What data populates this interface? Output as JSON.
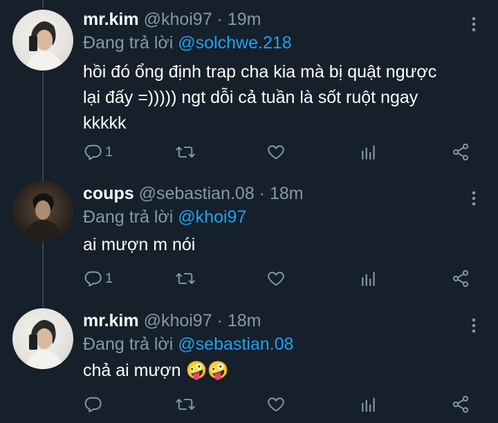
{
  "tweets": [
    {
      "name": "mr.kim",
      "handle": "@khoi97",
      "separator": "·",
      "time": "19m",
      "reply_prefix": "Đang trả lời",
      "reply_to": "@solchwe.218",
      "text_lines": [
        "hồi đó ổng định trap cha kia mà bị quật ngược",
        "lại đấy =))))) ngt dỗi cả tuần là sốt ruột ngay",
        "kkkkk"
      ],
      "reply_count": "1",
      "avatar": "kim"
    },
    {
      "name": "coups",
      "handle": "@sebastian.08",
      "separator": "·",
      "time": "18m",
      "reply_prefix": "Đang trả lời",
      "reply_to": "@khoi97",
      "text_lines": [
        "ai mượn m nói"
      ],
      "reply_count": "1",
      "avatar": "coups"
    },
    {
      "name": "mr.kim",
      "handle": "@khoi97",
      "separator": "·",
      "time": "18m",
      "reply_prefix": "Đang trả lời",
      "reply_to": "@sebastian.08",
      "text_lines": [
        "chả ai mượn 🤪🤪"
      ],
      "reply_count": "",
      "avatar": "kim"
    }
  ],
  "icons": {
    "reply": "comment-icon",
    "retweet": "retweet-icon",
    "like": "heart-icon",
    "analytics": "analytics-icon",
    "share": "share-icon",
    "more": "more-vertical-icon"
  },
  "colors": {
    "background": "#15202b",
    "text": "#ffffff",
    "secondary": "#8899a6",
    "mention": "#1da1f2",
    "thread_line": "#38444d"
  }
}
